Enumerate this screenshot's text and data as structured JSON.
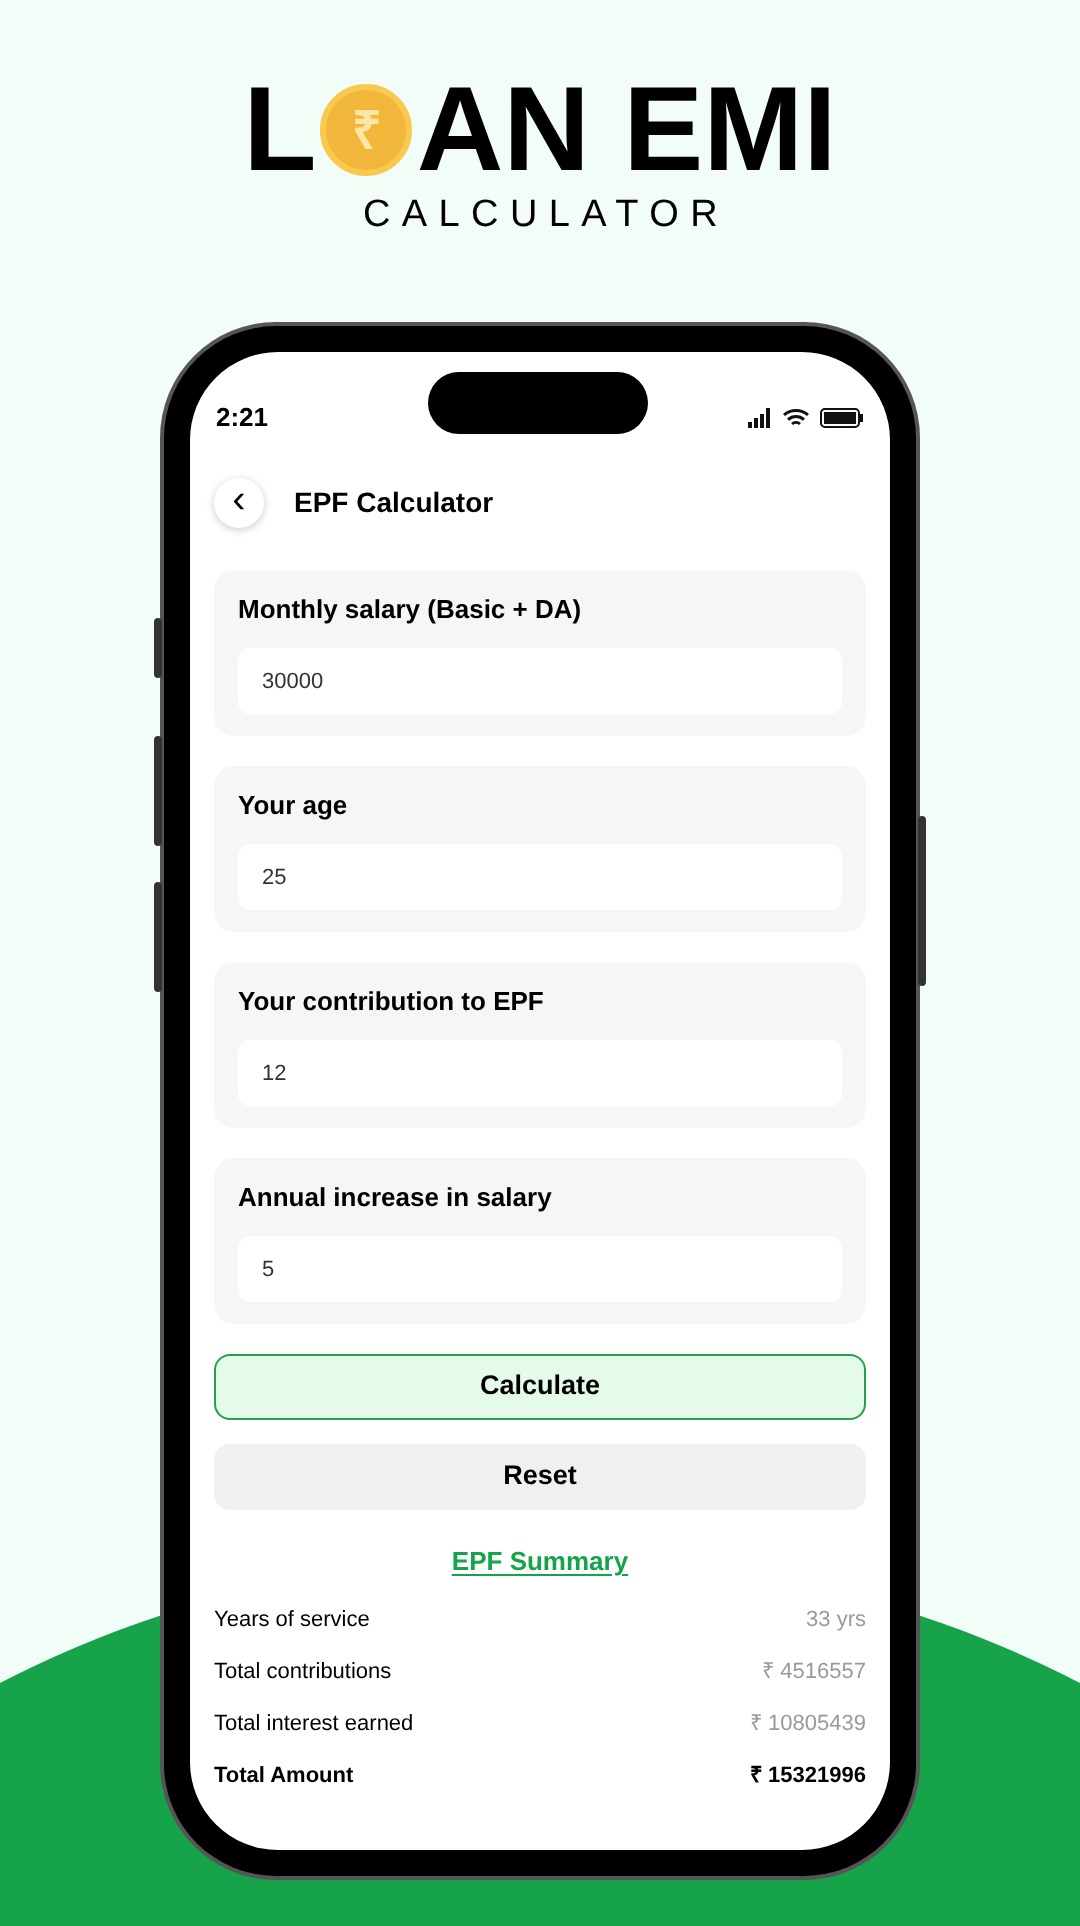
{
  "headline": {
    "before_coin": "L",
    "coin_symbol": "₹",
    "after_coin": "AN EMI",
    "subtitle": "CALCULATOR"
  },
  "status_bar": {
    "time": "2:21"
  },
  "header": {
    "back": "‹",
    "title": "EPF Calculator"
  },
  "fields": [
    {
      "label": "Monthly salary (Basic + DA)",
      "value": "30000"
    },
    {
      "label": "Your age",
      "value": "25"
    },
    {
      "label": "Your contribution to EPF",
      "value": "12"
    },
    {
      "label": "Annual increase in salary",
      "value": "5"
    }
  ],
  "buttons": [
    {
      "label": "Calculate",
      "kind": "primary"
    },
    {
      "label": "Reset",
      "kind": "secondary"
    }
  ],
  "summary": {
    "title": "EPF Summary",
    "rows": [
      {
        "label": "Years of service",
        "value": "33 yrs",
        "bold": false
      },
      {
        "label": "Total contributions",
        "value": "₹ 4516557",
        "bold": false
      },
      {
        "label": "Total interest earned",
        "value": "₹ 10805439",
        "bold": false
      },
      {
        "label": "Total Amount",
        "value": "₹ 15321996",
        "bold": true
      }
    ]
  }
}
